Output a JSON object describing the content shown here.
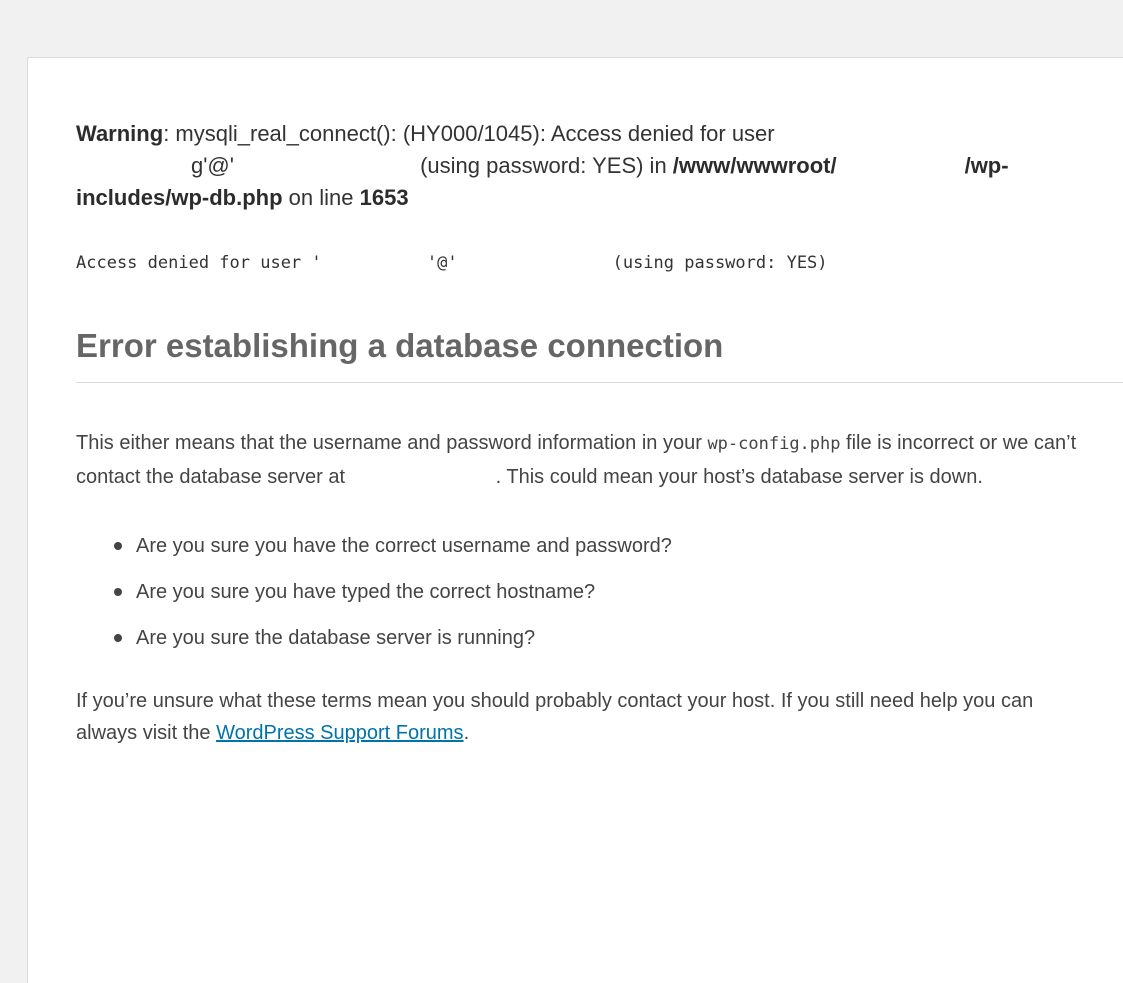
{
  "warning": {
    "label": "Warning",
    "sep": ": ",
    "message_a": "mysqli_real_connect(): (HY000/1045): Access denied for user",
    "user_tail": "g'@'",
    "message_b": " (using password: YES) in ",
    "path_a": "/www/wwwroot/",
    "path_b": "/wp-includes/wp-db.php",
    "on_line": " on line ",
    "line_number": "1653"
  },
  "mono_error": {
    "prefix": "Access denied for user '",
    "mid": " '@'",
    "suffix": "(using password: YES)"
  },
  "heading": "Error establishing a database connection",
  "intro": {
    "part_a": "This either means that the username and password information in your ",
    "config_file": "wp-config.php",
    "part_b": " file is incorrect or we can’t contact the database server at ",
    "part_c": ". This could mean your host’s database server is down."
  },
  "checks": [
    "Are you sure you have the correct username and password?",
    "Are you sure you have typed the correct hostname?",
    "Are you sure the database server is running?"
  ],
  "help": {
    "text": "If you’re unsure what these terms mean you should probably contact your host. If you still need help you can always visit the ",
    "link_label": "WordPress Support Forums",
    "end": "."
  },
  "colors": {
    "background": "#f1f1f1",
    "panel": "#ffffff",
    "heading": "#666666",
    "body_text": "#444444",
    "link": "#0073aa"
  }
}
